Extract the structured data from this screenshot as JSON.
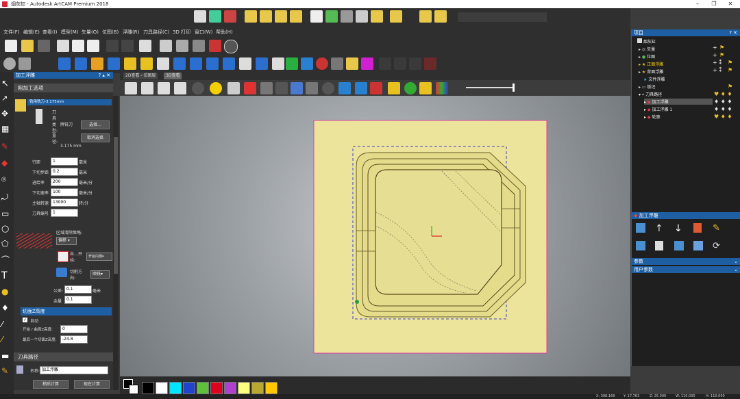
{
  "window": {
    "title": "烟灰缸 - Autodesk ArtCAM Premium 2018"
  },
  "menu": [
    "文件(F)",
    "编辑(E)",
    "查看(I)",
    "模型(M)",
    "矢量(O)",
    "位图(B)",
    "浮雕(R)",
    "刀具路径(C)",
    "3D 打印",
    "窗口(W)",
    "帮助(H)"
  ],
  "viewtabs": [
    "2D查看 - 位图层",
    "3D查看"
  ],
  "left_panel": {
    "header": "加工浮雕",
    "section_roughing": "粗加工选项",
    "tool_name": "铣用铣刀-3.175mm",
    "tool_type_label": "刀具类型:",
    "tool_type_value": "牌铣刀",
    "diameter_label": "直径:",
    "diameter_value": "3.175 mm",
    "select_button": "选择...",
    "deselect_button": "取消选择",
    "fields": [
      {
        "label": "行距",
        "value": "1",
        "unit": "毫米"
      },
      {
        "label": "下切步距",
        "value": "0.2",
        "unit": "毫米"
      },
      {
        "label": "进给率",
        "value": "200",
        "unit": "毫米/分"
      },
      {
        "label": "下切速率",
        "value": "100",
        "unit": "毫米/分"
      },
      {
        "label": "主轴转速",
        "value": "13000",
        "unit": "转/分"
      },
      {
        "label": "刀具编号",
        "value": "1",
        "unit": ""
      }
    ],
    "strategy_label": "区域清除策略:",
    "strategy_value": "偏移",
    "start_label": "自…开始:",
    "start_value": "开始内侧",
    "cut_dir_label": "切削方向:",
    "cut_dir_value": "顺铣",
    "tolerance_label": "公差:",
    "tolerance_value": "0.1",
    "tolerance_unit": "毫米",
    "allowance_label": "余量",
    "allowance_value": "0.1",
    "zheight_header": "切面Z高度",
    "auto_label": "自动",
    "start_height_label": "开始 / 曲面Z高度:",
    "start_height_value": "0",
    "last_cut_label": "最后一个切面Z高度:",
    "last_cut_value": "-24.8",
    "toolpath_header": "刀具路径",
    "name_label": "名称:",
    "name_value": "加工浮雕",
    "calc_later": "稍后计算",
    "calc_now": "现在计算"
  },
  "right_panel": {
    "header": "项目",
    "tree": [
      {
        "label": "烟灰缸",
        "level": 0,
        "color": "#eee"
      },
      {
        "label": "矢量",
        "level": 1,
        "color": "#eee"
      },
      {
        "label": "位图",
        "level": 1,
        "color": "#eee"
      },
      {
        "label": "正面浮雕",
        "level": 1,
        "color": "#f5d000"
      },
      {
        "label": "背面浮雕",
        "level": 1,
        "color": "#eee"
      },
      {
        "label": "文件浮雕",
        "level": 1,
        "color": "#eee"
      },
      {
        "label": "板坯",
        "level": 1,
        "color": "#eee"
      },
      {
        "label": "刀具路径",
        "level": 1,
        "color": "#eee"
      },
      {
        "label": "加工浮雕",
        "level": 2,
        "color": "#eee"
      },
      {
        "label": "加工浮雕 1",
        "level": 2,
        "color": "#eee"
      },
      {
        "label": "轮廓",
        "level": 2,
        "color": "#eee"
      }
    ],
    "ops_header": "加工浮雕",
    "params_header": "参数",
    "user_params_header": "用户参数"
  },
  "palette": [
    "#000000",
    "#ffffff",
    "#00e5ff",
    "#2244cc",
    "#5cc23a",
    "#e00020",
    "#b040d0",
    "#ffff80",
    "#b8a830",
    "#ffc800"
  ],
  "status": {
    "x": "X: 398.168",
    "y": "Y: 17.763",
    "z": "Z: 25.000",
    "w": "W: 110.000",
    "h": "H: 110.000"
  }
}
